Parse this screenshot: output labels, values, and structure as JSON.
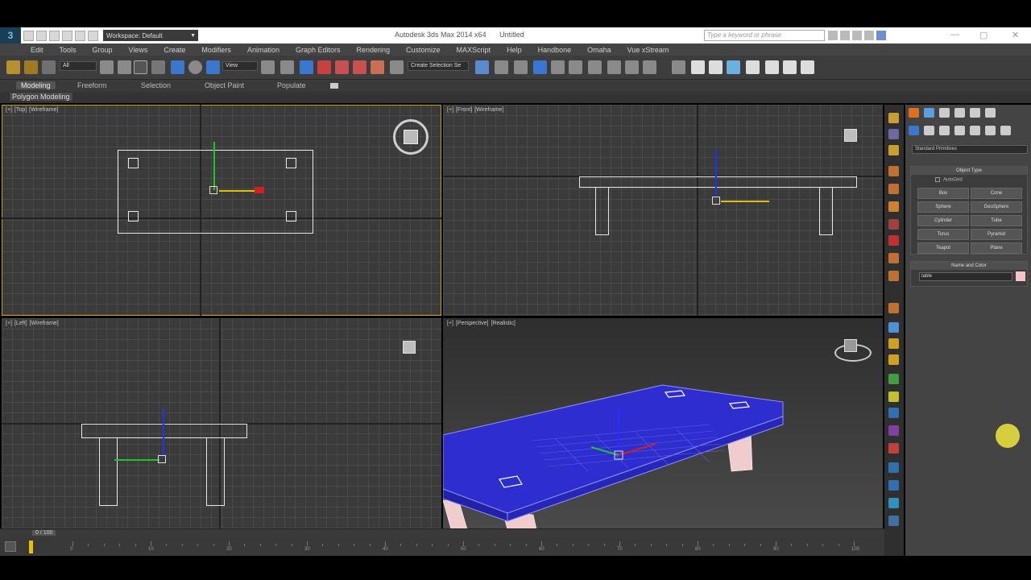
{
  "window": {
    "app_name": "Autodesk 3ds Max  2014 x64",
    "doc_name": "Untitled",
    "workspace": "Workspace: Default",
    "search_placeholder": "Type a keyword or phrase"
  },
  "menu": [
    "Edit",
    "Tools",
    "Group",
    "Views",
    "Create",
    "Modifiers",
    "Animation",
    "Graph Editors",
    "Rendering",
    "Customize",
    "MAXScript",
    "Help",
    "Handbone",
    "Omaha",
    "Vue xStream"
  ],
  "toolbar": {
    "selection_filter": "All",
    "ref_coord": "View",
    "named_selection": "Create Selection Se"
  },
  "ribbon": {
    "tabs": [
      "Modeling",
      "Freeform",
      "Selection",
      "Object Paint",
      "Populate"
    ],
    "active_tab": "Modeling",
    "panel_label": "Polygon Modeling"
  },
  "viewports": {
    "top": {
      "menu": "[+]",
      "pov": "[Top]",
      "shading": "[Wireframe]"
    },
    "front": {
      "menu": "[+]",
      "pov": "[Front]",
      "shading": "[Wireframe]"
    },
    "left": {
      "menu": "[+]",
      "pov": "[Left]",
      "shading": "[Wireframe]"
    },
    "perspective": {
      "menu": "[+]",
      "pov": "[Perspective]",
      "shading": "[Realistic]"
    }
  },
  "command_panel": {
    "category": "Standard Primitives",
    "object_type_header": "Object Type",
    "autogrid": "AutoGrid",
    "primitives": [
      "Box",
      "Cone",
      "Sphere",
      "GeoSphere",
      "Cylinder",
      "Tube",
      "Torus",
      "Pyramid",
      "Teapot",
      "Plane"
    ],
    "name_color_header": "Name and Color",
    "object_name": "table",
    "object_color": "#f3c3c8"
  },
  "timeline": {
    "frame_counter": "0 / 100",
    "ticks": [
      "0",
      "10",
      "20",
      "30",
      "40",
      "50",
      "60",
      "70",
      "80",
      "90",
      "100"
    ]
  },
  "colors": {
    "table_top": "#2e2ed0",
    "table_edges": "#9090ff",
    "legs": "#f0cccc",
    "active_border": "#c8a200"
  }
}
